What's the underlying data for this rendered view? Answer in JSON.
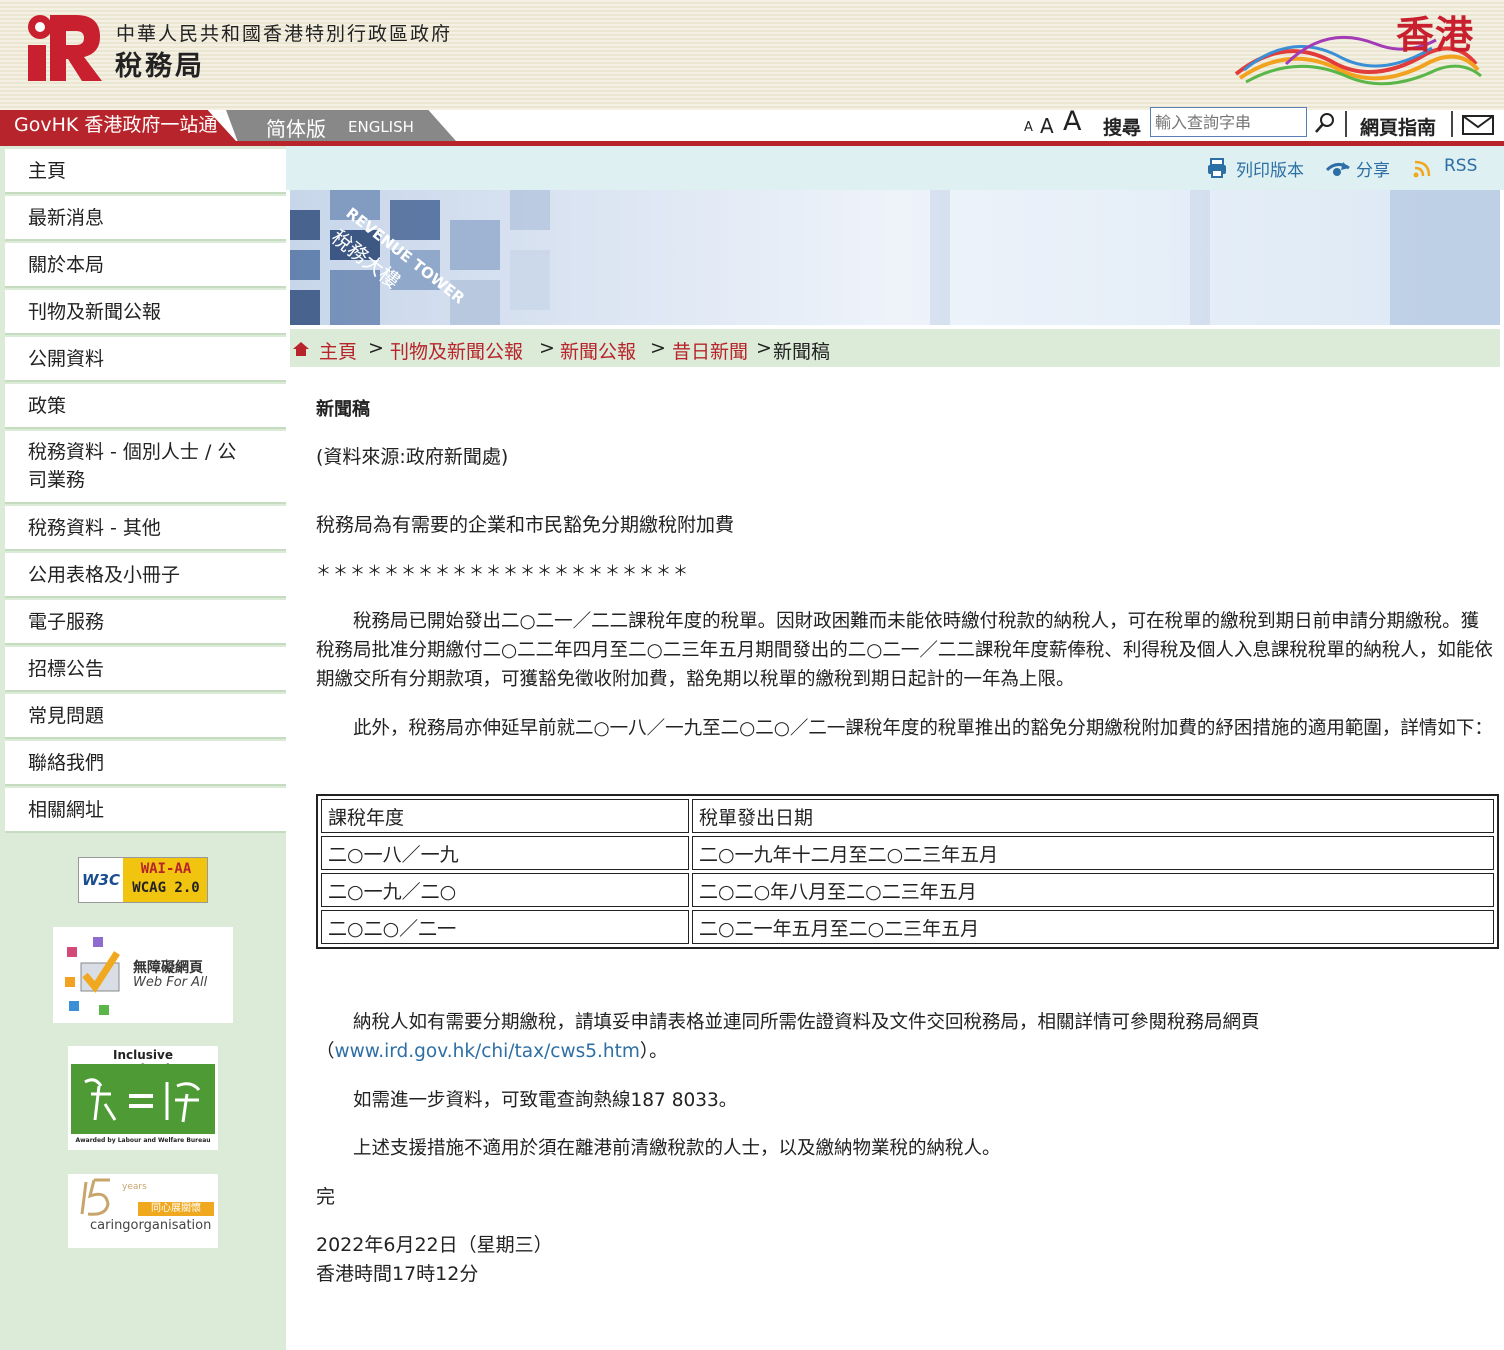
{
  "header": {
    "government_name": "中華人民共和國香港特別行政區政府",
    "department_name": "稅務局",
    "brand_text": "香港"
  },
  "topbar": {
    "govhk_label": "GovHK 香港政府一站通",
    "simplified_label": "简体版",
    "english_label": "ENGLISH",
    "font_small": "A",
    "font_medium": "A",
    "font_large": "A",
    "search_label": "搜尋",
    "search_placeholder": "輸入查詢字串",
    "sitemap_label": "網頁指南"
  },
  "sidebar": {
    "items": [
      {
        "label": "主頁"
      },
      {
        "label": "最新消息"
      },
      {
        "label": "關於本局"
      },
      {
        "label": "刊物及新聞公報"
      },
      {
        "label": "公開資料"
      },
      {
        "label": "政策"
      },
      {
        "label": "稅務資料 - 個別人士 / 公\n司業務"
      },
      {
        "label": "稅務資料 - 其他"
      },
      {
        "label": "公用表格及小冊子"
      },
      {
        "label": "電子服務"
      },
      {
        "label": "招標公告"
      },
      {
        "label": "常見問題"
      },
      {
        "label": "聯絡我們"
      },
      {
        "label": "相關網址"
      }
    ],
    "badges": {
      "w3c_left": "W3C",
      "w3c_top": "WAI-AA",
      "w3c_bottom": "WCAG 2.0",
      "webforall_cn": "無障礙網頁",
      "webforall_en": "Web For All",
      "inclusive_title": "Inclusive Organisation",
      "inclusive_footer": "Awarded by Labour and Welfare Bureau",
      "caring_years": "years",
      "caring_cn": "同心展關懷",
      "caring_text": "caringorganisation"
    }
  },
  "utility": {
    "print_label": "列印版本",
    "share_label": "分享",
    "rss_label": "RSS"
  },
  "banner": {
    "building_text": "REVENUE TOWER",
    "building_cn": "稅務大樓"
  },
  "breadcrumb": {
    "home": "主頁",
    "publications": "刊物及新聞公報",
    "press_releases": "新聞公報",
    "archive": "昔日新聞",
    "current": "新聞稿",
    "sep": ">"
  },
  "article": {
    "heading": "新聞稿",
    "source": "(資料來源:政府新聞處)",
    "title": "稅務局為有需要的企業和市民豁免分期繳稅附加費",
    "stars": "＊＊＊＊＊＊＊＊＊＊＊＊＊＊＊＊＊＊＊＊＊＊",
    "para1": "　　稅務局已開始發出二○二一／二二課稅年度的稅單。因財政困難而未能依時繳付稅款的納稅人，可在稅單的繳稅到期日前申請分期繳稅。獲稅務局批准分期繳付二○二二年四月至二○二三年五月期間發出的二○二一／二二課稅年度薪俸稅、利得稅及個人入息課稅稅單的納稅人，如能依期繳交所有分期款項，可獲豁免徵收附加費，豁免期以稅單的繳稅到期日起計的一年為上限。",
    "para2": "　　此外，稅務局亦伸延早前就二○一八／一九至二○二○／二一課稅年度的稅單推出的豁免分期繳稅附加費的紓困措施的適用範圍，詳情如下：",
    "table": {
      "headers": [
        "課稅年度",
        "稅單發出日期"
      ],
      "rows": [
        [
          "二○一八／一九",
          "二○一九年十二月至二○二三年五月"
        ],
        [
          "二○一九／二○",
          "二○二○年八月至二○二三年五月"
        ],
        [
          "二○二○／二一",
          "二○二一年五月至二○二三年五月"
        ]
      ]
    },
    "para3_a": "　　納稅人如有需要分期繳稅，請填妥申請表格並連同所需佐證資料及文件交回稅務局，相關詳情可參閱稅務局網頁",
    "para3_open": "（",
    "para3_link": "www.ird.gov.hk/chi/tax/cws5.htm",
    "para3_close": "）。",
    "para4": "　　如需進一步資料，可致電查詢熱線187 8033。",
    "para5": "　　上述支援措施不適用於須在離港前清繳稅款的人士，以及繳納物業稅的納稅人。",
    "end": "完",
    "date": "2022年6月22日（星期三）",
    "time": "香港時間17時12分"
  },
  "colors": {
    "brand_red": "#b8242b",
    "sidebar_green": "#dcebd8",
    "link_blue": "#2d6fa5"
  }
}
